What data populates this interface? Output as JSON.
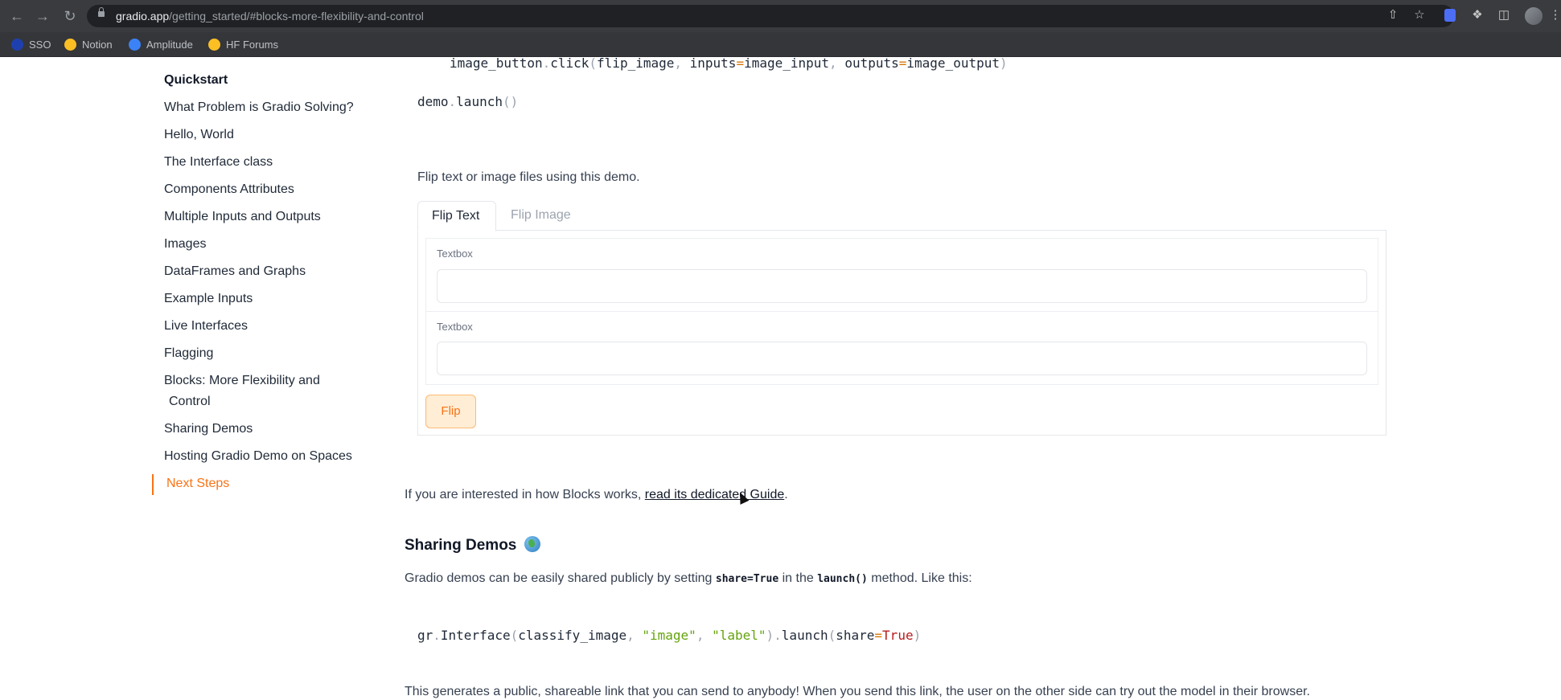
{
  "browser": {
    "url_domain": "gradio.app",
    "url_path": "/getting_started/#blocks-more-flexibility-and-control",
    "bookmarks": [
      {
        "label": "SSO",
        "icon": "sso-icon"
      },
      {
        "label": "Notion",
        "icon": "hugging-face-icon"
      },
      {
        "label": "Amplitude",
        "icon": "amplitude-icon"
      },
      {
        "label": "HF Forums",
        "icon": "hugging-face-icon"
      }
    ]
  },
  "sidebar": {
    "title": "Quickstart",
    "items": [
      "What Problem is Gradio Solving?",
      "Hello, World",
      "The Interface class",
      "Components Attributes",
      "Multiple Inputs and Outputs",
      "Images",
      "DataFrames and Graphs",
      "Example Inputs",
      "Live Interfaces",
      "Flagging",
      "Blocks: More Flexibility and",
      "Control",
      "Sharing Demos",
      "Hosting Gradio Demo on Spaces",
      "Next Steps"
    ],
    "active": "Next Steps"
  },
  "code1": {
    "line1_a": "image_button",
    "line1_b": ".",
    "line1_c": "click",
    "line1_d": "(",
    "line1_e": "flip_image",
    "line1_f": ", ",
    "line1_g": "inputs",
    "line1_h": "=",
    "line1_i": "image_input",
    "line1_j": ", ",
    "line1_k": "outputs",
    "line1_l": "=",
    "line1_m": "image_output",
    "line1_n": ")",
    "line2_a": "demo",
    "line2_b": ".",
    "line2_c": "launch",
    "line2_d": "()"
  },
  "demo": {
    "description": "Flip text or image files using this demo.",
    "tabs": [
      "Flip Text",
      "Flip Image"
    ],
    "textbox1_label": "Textbox",
    "textbox2_label": "Textbox",
    "button_label": "Flip"
  },
  "blocks_para": {
    "before": "If you are interested in how Blocks works, ",
    "link": "read its dedicated Guide",
    "after": "."
  },
  "sharing": {
    "heading": "Sharing Demos",
    "para_a": "Gradio demos can be easily shared publicly by setting ",
    "para_code1": "share=True",
    "para_b": " in the ",
    "para_code2": "launch()",
    "para_c": " method. Like this:",
    "code": {
      "a": "gr",
      "b": ".",
      "c": "Interface",
      "d": "(",
      "e": "classify_image",
      "f": ", ",
      "g": "\"image\"",
      "h": ", ",
      "i": "\"label\"",
      "j": ")",
      "k": ".",
      "l": "launch",
      "m": "(",
      "n": "share",
      "o": "=",
      "p": "True",
      "q": ")"
    },
    "last_para": "This generates a public, shareable link that you can send to anybody! When you send this link, the user on the other side can try out the model in their browser."
  }
}
